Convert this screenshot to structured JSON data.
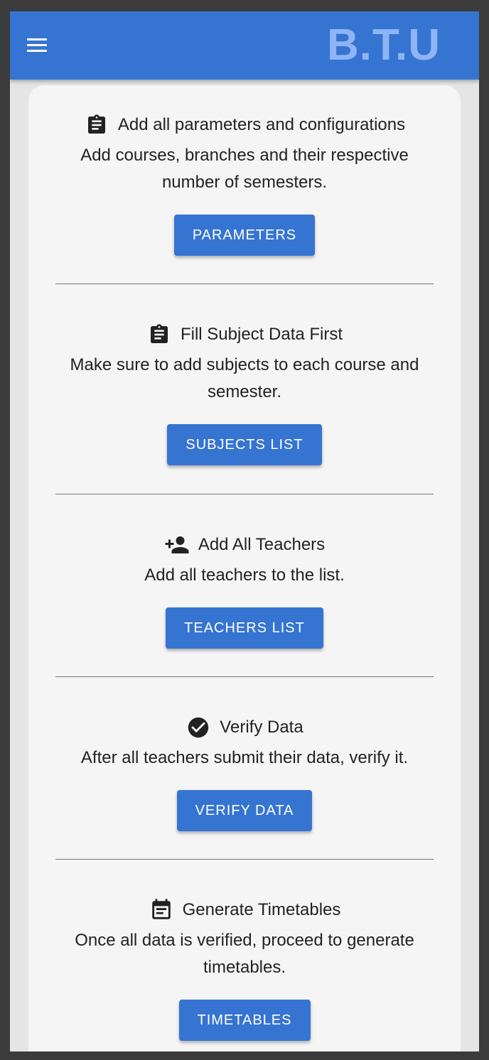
{
  "header": {
    "brand": "B.T.U",
    "menu_icon": "hamburger-menu-icon"
  },
  "sections": [
    {
      "icon": "clipboard-icon",
      "title": "Add all parameters and configurations",
      "description": "Add courses, branches and their respective number of semesters.",
      "button": "PARAMETERS"
    },
    {
      "icon": "clipboard-icon",
      "title": "Fill Subject Data First",
      "description": "Make sure to add subjects to each course and semester.",
      "button": "SUBJECTS LIST"
    },
    {
      "icon": "person-add-icon",
      "title": "Add All Teachers",
      "description": "Add all teachers to the list.",
      "button": "TEACHERS LIST"
    },
    {
      "icon": "check-circle-icon",
      "title": "Verify Data",
      "description": "After all teachers submit their data, verify it.",
      "button": "VERIFY DATA"
    },
    {
      "icon": "calendar-icon",
      "title": "Generate Timetables",
      "description": "Once all data is verified, proceed to generate timetables.",
      "button": "TIMETABLES"
    }
  ],
  "colors": {
    "primary": "#3674d1",
    "brand_text": "#8fb4f5",
    "card_bg": "#f5f5f5"
  }
}
